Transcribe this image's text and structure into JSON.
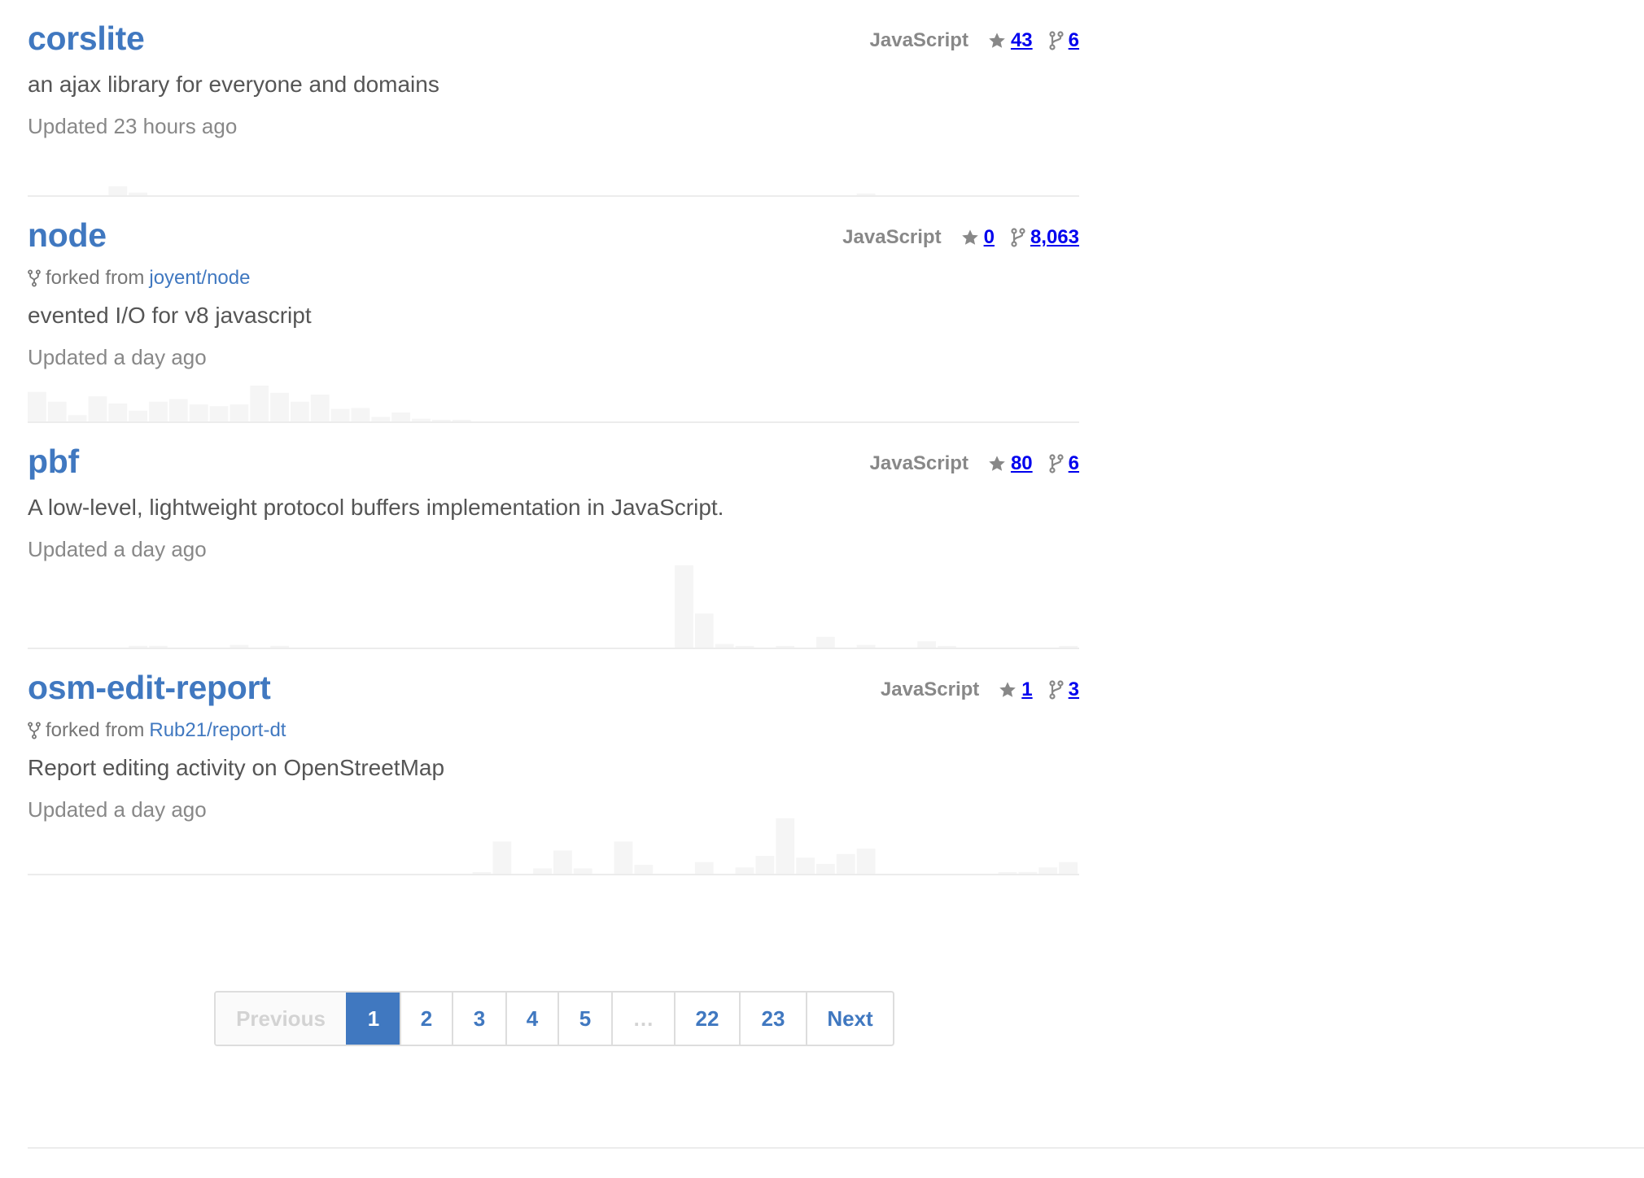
{
  "repos": [
    {
      "name": "corslite",
      "language": "JavaScript",
      "stars": "43",
      "forks": "6",
      "forked_from": null,
      "description": "an ajax library for everyone and domains",
      "updated": "Updated 23 hours ago",
      "activity": [
        0,
        0,
        0,
        0,
        0.1,
        0.03,
        0,
        0,
        0,
        0,
        0,
        0,
        0,
        0,
        0,
        0,
        0,
        0,
        0,
        0,
        0,
        0,
        0,
        0,
        0,
        0,
        0,
        0,
        0,
        0,
        0,
        0,
        0,
        0,
        0,
        0,
        0,
        0,
        0,
        0,
        0,
        0.02,
        0,
        0,
        0,
        0,
        0,
        0,
        0,
        0,
        0,
        0
      ]
    },
    {
      "name": "node",
      "language": "JavaScript",
      "stars": "0",
      "forks": "8,063",
      "forked_from": {
        "prefix": "forked from",
        "repo": "joyent/node"
      },
      "description": "evented I/O for v8 javascript",
      "updated": "Updated a day ago",
      "activity": [
        0.33,
        0.22,
        0.07,
        0.28,
        0.2,
        0.12,
        0.22,
        0.25,
        0.19,
        0.17,
        0.19,
        0.4,
        0.32,
        0.22,
        0.3,
        0.14,
        0.15,
        0.05,
        0.1,
        0.03,
        0.01,
        0.01,
        0,
        0,
        0,
        0,
        0,
        0,
        0,
        0,
        0,
        0,
        0,
        0,
        0,
        0,
        0,
        0,
        0,
        0,
        0,
        0,
        0,
        0,
        0,
        0,
        0,
        0,
        0,
        0,
        0,
        0
      ]
    },
    {
      "name": "pbf",
      "language": "JavaScript",
      "stars": "80",
      "forks": "6",
      "forked_from": null,
      "description": "A low-level, lightweight protocol buffers implementation in JavaScript.",
      "updated": "Updated a day ago",
      "activity": [
        0,
        0,
        0,
        0,
        0,
        0.02,
        0.02,
        0,
        0,
        0,
        0.03,
        0,
        0.02,
        0,
        0,
        0,
        0,
        0,
        0,
        0,
        0,
        0,
        0,
        0,
        0,
        0,
        0,
        0,
        0,
        0,
        0,
        0,
        0.92,
        0.38,
        0.04,
        0.01,
        0,
        0.01,
        0,
        0.12,
        0,
        0.03,
        0,
        0,
        0.07,
        0.01,
        0,
        0,
        0,
        0,
        0,
        0.01
      ]
    },
    {
      "name": "osm-edit-report",
      "language": "JavaScript",
      "stars": "1",
      "forks": "3",
      "forked_from": {
        "prefix": "forked from",
        "repo": "Rub21/report-dt"
      },
      "description": "Report editing activity on OpenStreetMap",
      "updated": "Updated a day ago",
      "activity": [
        0,
        0,
        0,
        0,
        0,
        0,
        0,
        0,
        0,
        0,
        0,
        0,
        0,
        0,
        0,
        0,
        0,
        0,
        0,
        0,
        0,
        0,
        0.01,
        0.36,
        0,
        0.06,
        0.26,
        0.06,
        0,
        0.36,
        0.1,
        0,
        0,
        0.13,
        0,
        0.07,
        0.2,
        0.62,
        0.18,
        0.11,
        0.22,
        0.28,
        0,
        0,
        0,
        0,
        0,
        0,
        0.01,
        0.02,
        0.07,
        0.13
      ]
    }
  ],
  "pagination": {
    "previous": "Previous",
    "pages": [
      "1",
      "2",
      "3",
      "4",
      "5"
    ],
    "gap": "…",
    "last_pages": [
      "22",
      "23"
    ],
    "next": "Next",
    "current": "1"
  },
  "colors": {
    "link": "#4078c0",
    "muted": "#888888",
    "activity_bar": "#f5f5f5"
  },
  "icons": {
    "star": "star-icon",
    "fork": "repo-forked-icon"
  }
}
